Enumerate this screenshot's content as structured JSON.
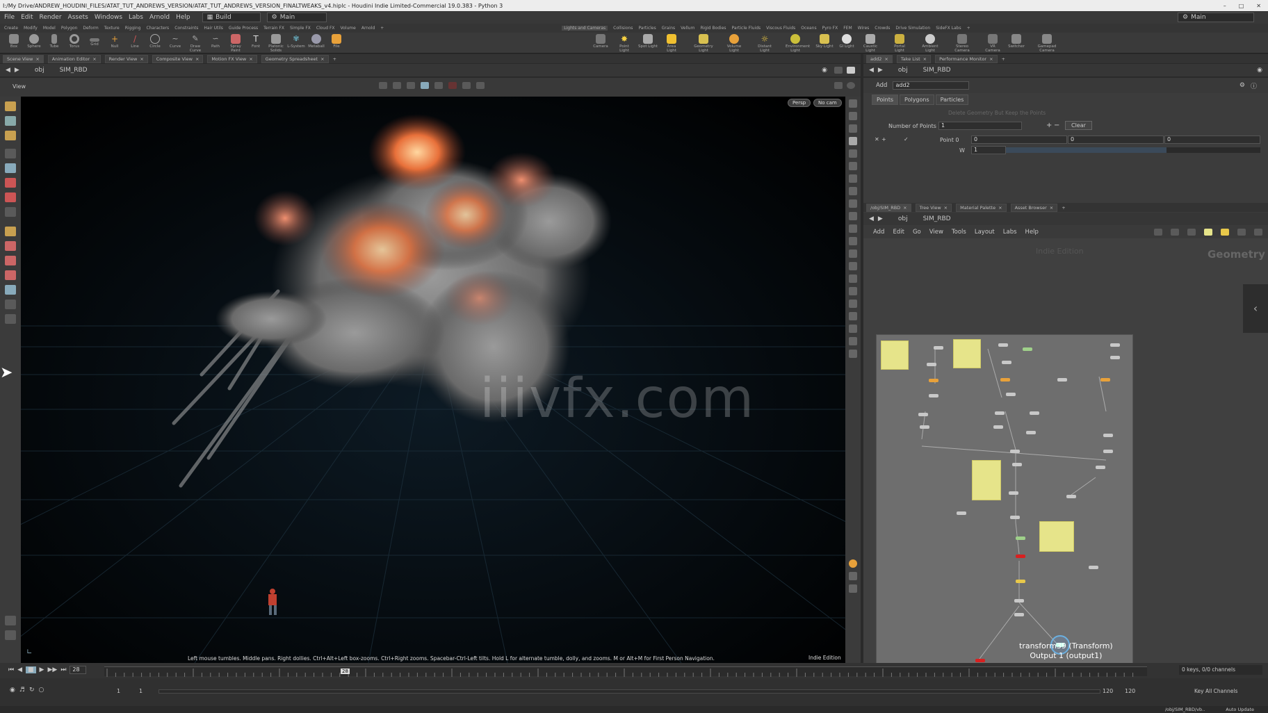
{
  "title": "I:/My Drive/ANDREW_HOUDINI_FILES/ATAT_TUT_ANDREWS_VERSION/ATAT_TUT_ANDREWS_VERSION_FINALTWEAKS_v4.hiplc - Houdini Indie Limited-Commercial 19.0.383 - Python 3",
  "menu": [
    "File",
    "Edit",
    "Render",
    "Assets",
    "Windows",
    "Labs",
    "Arnold",
    "Help"
  ],
  "desktop": "Build",
  "main_combo": "Main",
  "main_right": "Main",
  "shelf_tabs_left": [
    "Create",
    "Modify",
    "Model",
    "Polygon",
    "Deform",
    "Texture",
    "Rigging",
    "Characters",
    "Constraints",
    "Hair Utils",
    "Guide Process",
    "Terrain FX",
    "Simple FX",
    "Cloud FX",
    "Volume",
    "Arnold"
  ],
  "shelf_tabs_right": [
    "Lights and Cameras",
    "Collisions",
    "Particles",
    "Grains",
    "Vellum",
    "Rigid Bodies",
    "Particle Fluids",
    "Viscous Fluids",
    "Oceans",
    "Pyro FX",
    "FEM",
    "Wires",
    "Crowds",
    "Drive Simulation",
    "SideFX Labs"
  ],
  "tools_left": [
    "Box",
    "Sphere",
    "Tube",
    "Torus",
    "Grid",
    "Null",
    "Line",
    "Circle",
    "Curve",
    "Draw Curve",
    "Path",
    "Spray Paint",
    "Font",
    "Platonic Solids",
    "L-System",
    "Metaball",
    "File"
  ],
  "tools_right": [
    "Camera",
    "Point Light",
    "Spot Light",
    "Area Light",
    "Geometry Light",
    "Volume Light",
    "Distant Light",
    "Environment Light",
    "Sky Light",
    "GI Light",
    "Caustic Light",
    "Portal Light",
    "Ambient Light",
    "Stereo Camera",
    "VR Camera",
    "Switcher",
    "Gamepad Camera"
  ],
  "left_tabs": [
    "Scene View",
    "Animation Editor",
    "Render View",
    "Composite View",
    "Motion FX View",
    "Geometry Spreadsheet"
  ],
  "left_path": {
    "root": "obj",
    "node": "SIM_RBD"
  },
  "view_label": "View",
  "persp": "Persp",
  "cam": "No cam",
  "watermark": "iiivfx.com",
  "hint": "Left mouse tumbles. Middle pans. Right dollies. Ctrl+Alt+Left box-zooms. Ctrl+Right zooms. Spacebar-Ctrl-Left tilts. Hold L for alternate tumble, dolly, and zooms.    M or Alt+M for First Person Navigation.",
  "edition": "Indie Edition",
  "right_tabs": [
    "add2",
    "Take List",
    "Performance Monitor"
  ],
  "right_path": {
    "root": "obj",
    "node": "SIM_RBD"
  },
  "param": {
    "type": "Add",
    "name": "add2",
    "tabs": [
      "Points",
      "Polygons",
      "Particles"
    ],
    "subheading": "Delete Geometry But Keep the Points",
    "num_points_label": "Number of Points",
    "num_points": "1",
    "clear": "Clear",
    "point0_label": "Point 0",
    "p0": [
      "0",
      "0",
      "0"
    ],
    "w_label": "W",
    "w": "1"
  },
  "net_tabs": [
    "/obj/SIM_RBD",
    "Tree View",
    "Material Palette",
    "Asset Browser"
  ],
  "net_path": {
    "root": "obj",
    "node": "SIM_RBD"
  },
  "net_menu": [
    "Add",
    "Edit",
    "Go",
    "View",
    "Tools",
    "Layout",
    "Labs",
    "Help"
  ],
  "net_watermark": "Indie Edition",
  "net_context": "Geometry",
  "node_label": {
    "line1": "transform39 (Transform)",
    "line2": "Output 1 (output1)"
  },
  "timeline": {
    "frame": "28",
    "ruler_ticks": [
      "1",
      "",
      "",
      "",
      "",
      "",
      "",
      "",
      "",
      "",
      "",
      "",
      "",
      "",
      "",
      "",
      "",
      "",
      "",
      "",
      "",
      "",
      "",
      "",
      "",
      "",
      "",
      "28"
    ],
    "start": "1",
    "start2": "1",
    "end": "120",
    "end2": "120"
  },
  "keys": "0 keys, 0/0 channels",
  "key_all": "Key All Channels",
  "status_path": "/obj/SIM_RBD/vb..",
  "auto_update": "Auto Update",
  "colors": {
    "accent": "#e8a13a",
    "note": "#e6e48a",
    "error_node": "#d82020"
  }
}
